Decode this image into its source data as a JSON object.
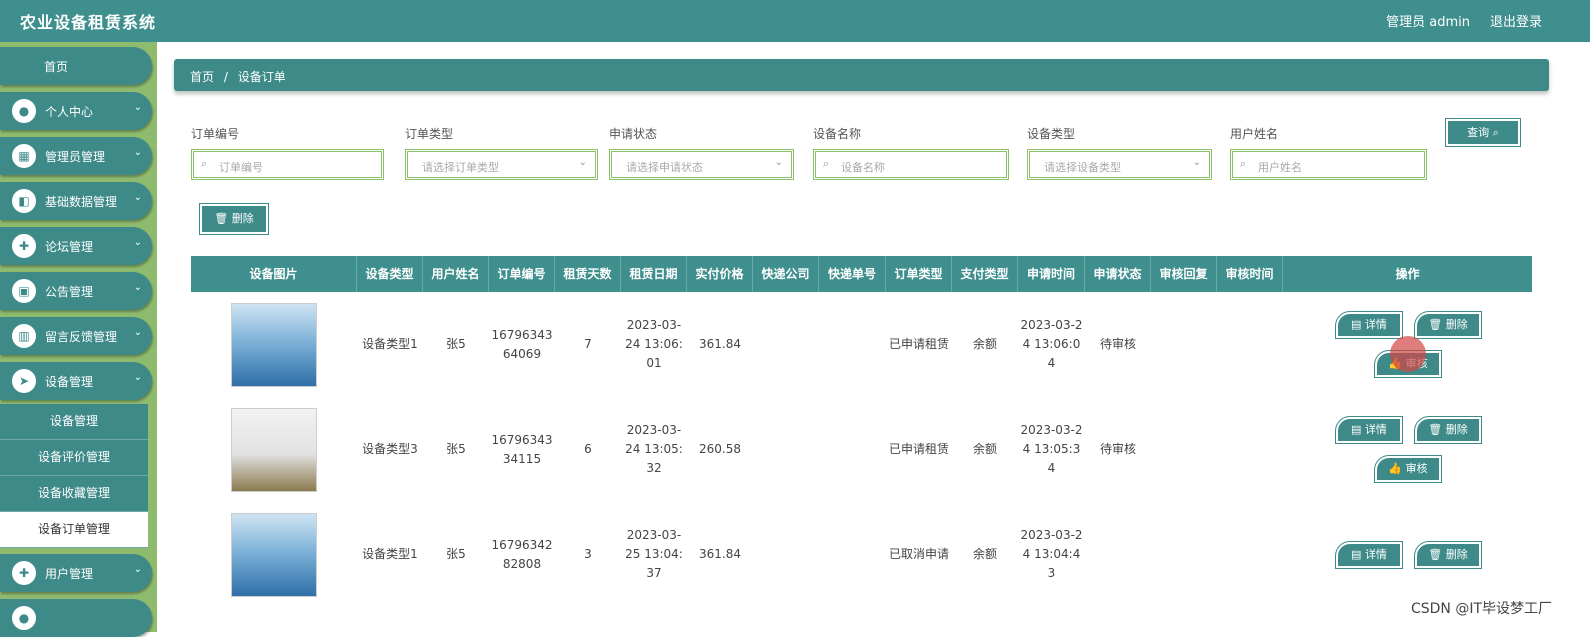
{
  "app": {
    "title": "农业设备租赁系统",
    "admin": "管理员 admin",
    "logout": "退出登录"
  },
  "sidebar": {
    "home": "首页",
    "items": [
      {
        "label": "个人中心",
        "icon": "user-icon"
      },
      {
        "label": "管理员管理",
        "icon": "grid-icon"
      },
      {
        "label": "基础数据管理",
        "icon": "wallet-icon"
      },
      {
        "label": "论坛管理",
        "icon": "apps-icon"
      },
      {
        "label": "公告管理",
        "icon": "print-icon"
      },
      {
        "label": "留言反馈管理",
        "icon": "chart-icon"
      },
      {
        "label": "设备管理",
        "icon": "send-icon"
      }
    ],
    "sub_items": [
      "设备管理",
      "设备评价管理",
      "设备收藏管理",
      "设备订单管理"
    ],
    "after": {
      "label": "用户管理",
      "icon": "apps-icon"
    }
  },
  "breadcrumb": {
    "home": "首页",
    "sep": "/",
    "current": "设备订单"
  },
  "filters": [
    {
      "label": "订单编号",
      "placeholder": "订单编号",
      "type": "text"
    },
    {
      "label": "订单类型",
      "placeholder": "请选择订单类型",
      "type": "select"
    },
    {
      "label": "申请状态",
      "placeholder": "请选择申请状态",
      "type": "select"
    },
    {
      "label": "设备名称",
      "placeholder": "设备名称",
      "type": "text"
    },
    {
      "label": "设备类型",
      "placeholder": "请选择设备类型",
      "type": "select"
    },
    {
      "label": "用户姓名",
      "placeholder": "用户姓名",
      "type": "text"
    }
  ],
  "buttons": {
    "search": "查询",
    "delete": "删除"
  },
  "table": {
    "columns": [
      "设备图片",
      "设备类型",
      "用户姓名",
      "订单编号",
      "租赁天数",
      "租赁日期",
      "实付价格",
      "快递公司",
      "快递单号",
      "订单类型",
      "支付类型",
      "申请时间",
      "申请状态",
      "审核回复",
      "审核时间",
      "操作"
    ],
    "rows": [
      {
        "type": "设备类型1",
        "user": "张5",
        "order_no": "1679634364069",
        "days": "7",
        "date": "2023-03-24 13:06:01",
        "price": "361.84",
        "express": "",
        "express_no": "",
        "order_type": "已申请租赁",
        "pay": "余额",
        "apply_time": "2023-03-24 13:06:04",
        "status": "待审核",
        "reply": "",
        "review_time": "",
        "actions": [
          "详情",
          "删除",
          "审核"
        ]
      },
      {
        "type": "设备类型3",
        "user": "张5",
        "order_no": "1679634334115",
        "days": "6",
        "date": "2023-03-24 13:05:32",
        "price": "260.58",
        "express": "",
        "express_no": "",
        "order_type": "已申请租赁",
        "pay": "余额",
        "apply_time": "2023-03-24 13:05:34",
        "status": "待审核",
        "reply": "",
        "review_time": "",
        "actions": [
          "详情",
          "删除",
          "审核"
        ]
      },
      {
        "type": "设备类型1",
        "user": "张5",
        "order_no": "1679634282808",
        "days": "3",
        "date": "2023-03-25 13:04:37",
        "price": "361.84",
        "express": "",
        "express_no": "",
        "order_type": "已取消申请",
        "pay": "余额",
        "apply_time": "2023-03-24 13:04:43",
        "status": "",
        "reply": "",
        "review_time": "",
        "actions": [
          "详情",
          "删除"
        ]
      }
    ]
  },
  "watermark": "CSDN @IT毕设梦工厂",
  "colors": {
    "primary": "#3d8a88",
    "sidebar_bg": "#8fbb6f",
    "input_border": "#8cc06a"
  }
}
